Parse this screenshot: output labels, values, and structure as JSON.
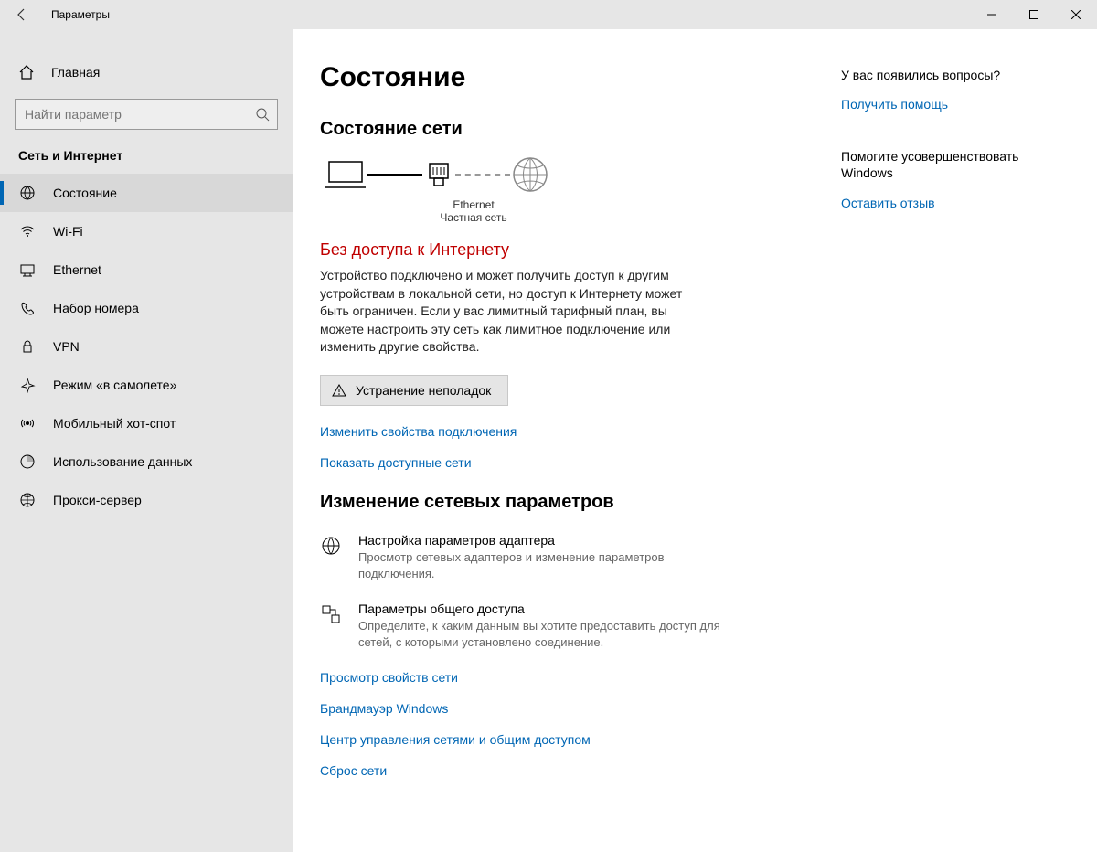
{
  "window": {
    "title": "Параметры"
  },
  "sidebar": {
    "home": "Главная",
    "search_placeholder": "Найти параметр",
    "section": "Сеть и Интернет",
    "items": [
      {
        "label": "Состояние"
      },
      {
        "label": "Wi-Fi"
      },
      {
        "label": "Ethernet"
      },
      {
        "label": "Набор номера"
      },
      {
        "label": "VPN"
      },
      {
        "label": "Режим «в самолете»"
      },
      {
        "label": "Мобильный хот-спот"
      },
      {
        "label": "Использование данных"
      },
      {
        "label": "Прокси-сервер"
      }
    ]
  },
  "main": {
    "page_title": "Состояние",
    "net_status_title": "Состояние сети",
    "diagram": {
      "adapter": "Ethernet",
      "network_kind": "Частная сеть"
    },
    "status_heading": "Без доступа к Интернету",
    "status_body": "Устройство подключено и может получить доступ к другим устройствам в локальной сети, но доступ к Интернету может быть ограничен. Если у вас лимитный тарифный план, вы можете настроить эту сеть как лимитное подключение или изменить другие свойства.",
    "troubleshoot": "Устранение неполадок",
    "link_change_props": "Изменить свойства подключения",
    "link_show_networks": "Показать доступные сети",
    "change_settings_title": "Изменение сетевых параметров",
    "options": [
      {
        "title": "Настройка параметров адаптера",
        "desc": "Просмотр сетевых адаптеров и изменение параметров подключения."
      },
      {
        "title": "Параметры общего доступа",
        "desc": "Определите, к каким данным вы хотите предоставить доступ для сетей, с которыми установлено соединение."
      }
    ],
    "link_view_props": "Просмотр свойств сети",
    "link_firewall": "Брандмауэр Windows",
    "link_sharing_center": "Центр управления сетями и общим доступом",
    "link_reset": "Сброс сети"
  },
  "right": {
    "questions_heading": "У вас появились вопросы?",
    "get_help": "Получить помощь",
    "improve_heading": "Помогите усовершенствовать Windows",
    "feedback": "Оставить отзыв"
  }
}
